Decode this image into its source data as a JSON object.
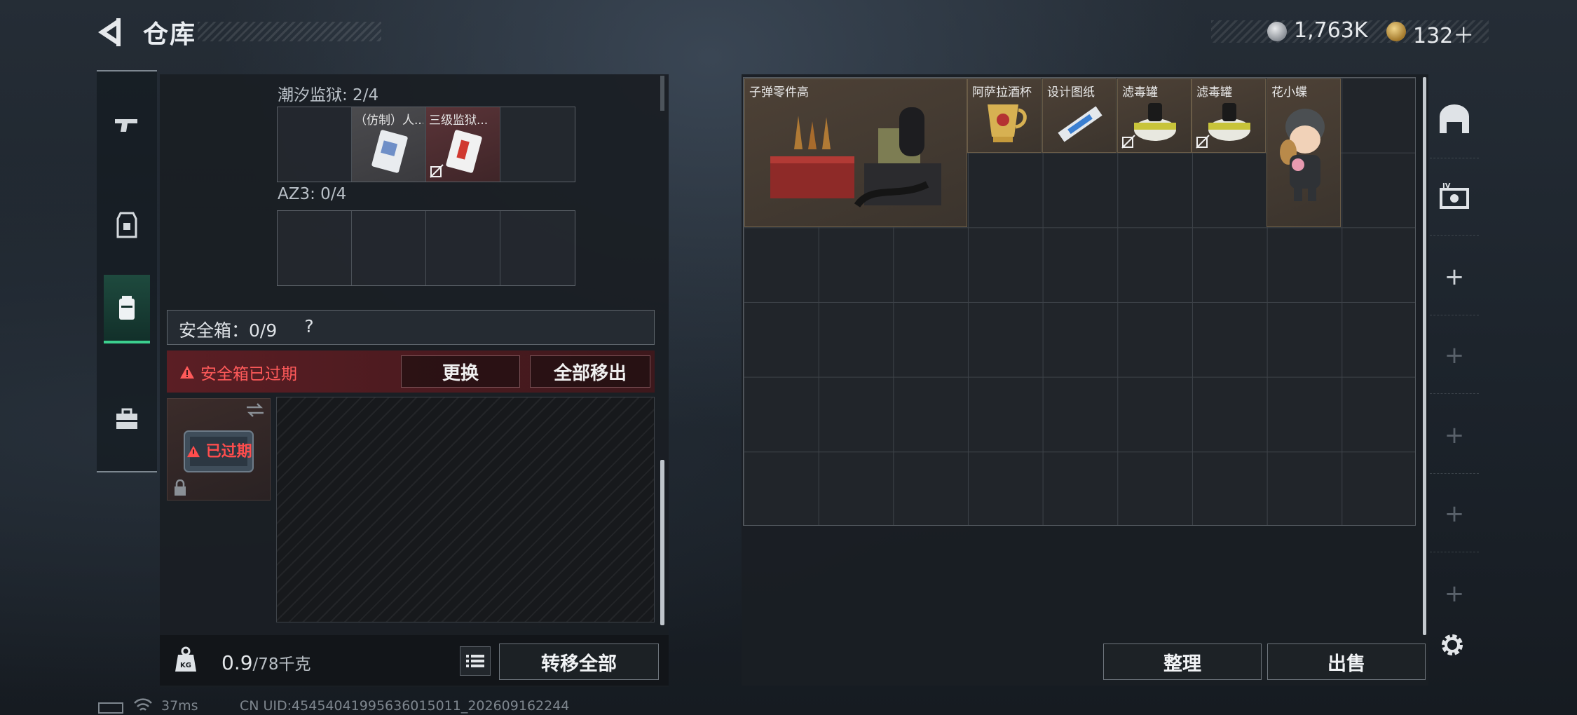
{
  "header": {
    "title": "仓库"
  },
  "currency": {
    "silver": "1,763K",
    "gold": "132＋"
  },
  "left": {
    "sections": [
      {
        "label": "潮汐监狱: 2/4",
        "items": [
          "",
          "（仿制）人...",
          "三级监狱...",
          ""
        ]
      },
      {
        "label": "AZ3: 0/4"
      }
    ],
    "safe": {
      "title": "安全箱：0/9",
      "help": "?",
      "warning": "安全箱已过期",
      "replace_label": "更换",
      "move_out_label": "全部移出",
      "expired_label": "已过期"
    },
    "weight": {
      "current": "0.9",
      "max": "/78千克"
    },
    "transfer_all_label": "转移全部"
  },
  "storage": {
    "items": [
      {
        "name": "子弹零件高"
      },
      {
        "name": "阿萨拉酒杯"
      },
      {
        "name": "设计图纸"
      },
      {
        "name": "滤毒罐"
      },
      {
        "name": "滤毒罐"
      },
      {
        "name": "花小蝶"
      }
    ],
    "sort_label": "整理",
    "sell_label": "出售"
  },
  "side_tabs": {
    "plus": "+"
  },
  "status": {
    "ping": "37ms",
    "uid": "CN UID:45454041995636015011_202609162244"
  },
  "colors": {
    "accent_green": "#3ccf8e",
    "warning_red": "#ff5a5a"
  }
}
